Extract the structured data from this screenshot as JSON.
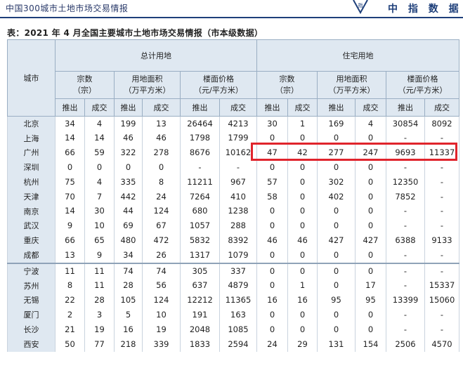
{
  "header": {
    "doc_title": "中国300城市土地市场交易情报",
    "brand": "中 指 数 据",
    "logo_label": "指"
  },
  "caption": "表：2021 年 4 月全国主要城市土地市场交易情报（市本级数据）",
  "table": {
    "city_header": "城市",
    "group_total": "总计用地",
    "group_residential": "住宅用地",
    "metrics": {
      "count": "宗数",
      "count_unit": "（宗）",
      "area": "用地面积",
      "area_unit": "（万平方米）",
      "price": "楼面价格",
      "price_unit": "（元/平方米）"
    },
    "sub": {
      "push": "推出",
      "deal": "成交"
    },
    "rows": [
      {
        "city": "北京",
        "v": [
          "34",
          "4",
          "199",
          "13",
          "26464",
          "4213",
          "30",
          "1",
          "169",
          "4",
          "30854",
          "8092"
        ]
      },
      {
        "city": "上海",
        "v": [
          "14",
          "14",
          "46",
          "46",
          "1798",
          "1799",
          "0",
          "0",
          "0",
          "0",
          "-",
          "-"
        ]
      },
      {
        "city": "广州",
        "v": [
          "66",
          "59",
          "322",
          "278",
          "8676",
          "10162",
          "47",
          "42",
          "277",
          "247",
          "9693",
          "11337"
        ]
      },
      {
        "city": "深圳",
        "v": [
          "0",
          "0",
          "0",
          "0",
          "-",
          "-",
          "0",
          "0",
          "0",
          "0",
          "-",
          "-"
        ]
      },
      {
        "city": "杭州",
        "v": [
          "75",
          "4",
          "335",
          "8",
          "11211",
          "967",
          "57",
          "0",
          "302",
          "0",
          "12350",
          "-"
        ]
      },
      {
        "city": "天津",
        "v": [
          "70",
          "7",
          "442",
          "24",
          "7264",
          "410",
          "58",
          "0",
          "402",
          "0",
          "7852",
          "-"
        ]
      },
      {
        "city": "南京",
        "v": [
          "14",
          "30",
          "44",
          "124",
          "680",
          "1238",
          "0",
          "0",
          "0",
          "0",
          "-",
          "-"
        ]
      },
      {
        "city": "武汉",
        "v": [
          "9",
          "10",
          "69",
          "67",
          "1057",
          "288",
          "0",
          "0",
          "0",
          "0",
          "-",
          "-"
        ]
      },
      {
        "city": "重庆",
        "v": [
          "66",
          "65",
          "480",
          "472",
          "5832",
          "8392",
          "46",
          "46",
          "427",
          "427",
          "6388",
          "9133"
        ]
      },
      {
        "city": "成都",
        "v": [
          "13",
          "9",
          "34",
          "26",
          "1317",
          "1079",
          "0",
          "0",
          "0",
          "0",
          "-",
          "-"
        ]
      },
      {
        "city": "宁波",
        "v": [
          "11",
          "11",
          "74",
          "74",
          "305",
          "337",
          "0",
          "0",
          "0",
          "0",
          "-",
          "-"
        ]
      },
      {
        "city": "苏州",
        "v": [
          "8",
          "11",
          "28",
          "56",
          "637",
          "4879",
          "0",
          "1",
          "0",
          "17",
          "-",
          "15337"
        ]
      },
      {
        "city": "无锡",
        "v": [
          "22",
          "28",
          "105",
          "124",
          "12212",
          "11365",
          "16",
          "16",
          "95",
          "95",
          "13399",
          "15060"
        ]
      },
      {
        "city": "厦门",
        "v": [
          "2",
          "3",
          "5",
          "10",
          "191",
          "163",
          "0",
          "0",
          "0",
          "0",
          "-",
          "-"
        ]
      },
      {
        "city": "长沙",
        "v": [
          "21",
          "19",
          "16",
          "19",
          "2048",
          "1085",
          "0",
          "0",
          "0",
          "0",
          "-",
          "-"
        ]
      },
      {
        "city": "西安",
        "v": [
          "50",
          "77",
          "218",
          "339",
          "1833",
          "2594",
          "24",
          "29",
          "131",
          "154",
          "2506",
          "4570"
        ]
      }
    ]
  }
}
